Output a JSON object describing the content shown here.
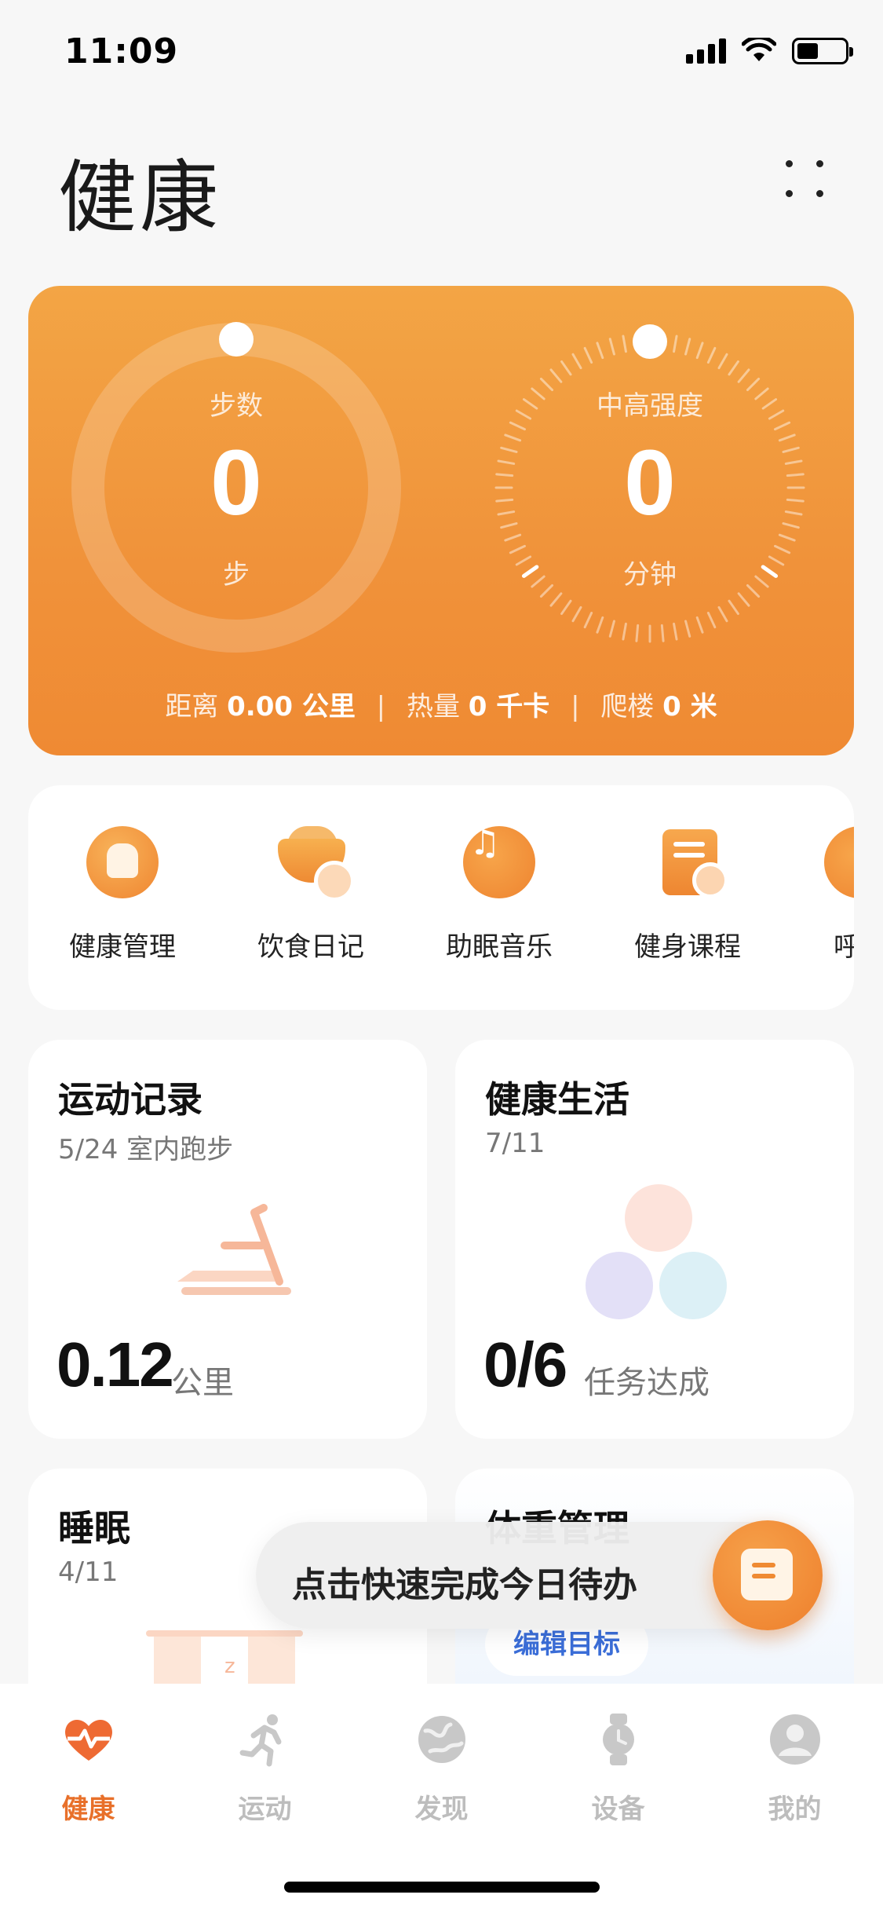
{
  "status_bar": {
    "time": "11:09"
  },
  "header": {
    "title": "健康"
  },
  "activity": {
    "steps": {
      "label": "步数",
      "value": "0",
      "unit": "步"
    },
    "intensity": {
      "label": "中高强度",
      "value": "0",
      "unit": "分钟"
    },
    "stats": {
      "distance_label": "距离",
      "distance_value": "0.00 公里",
      "calories_label": "热量",
      "calories_value": "0 千卡",
      "floors_label": "爬楼",
      "floors_value": "0 米"
    }
  },
  "shortcuts": [
    {
      "label": "健康管理",
      "icon": "health-management-icon"
    },
    {
      "label": "饮食日记",
      "icon": "diet-diary-icon"
    },
    {
      "label": "助眠音乐",
      "icon": "sleep-music-icon"
    },
    {
      "label": "健身课程",
      "icon": "fitness-course-icon"
    },
    {
      "label": "呼吸",
      "icon": "breathing-icon"
    }
  ],
  "tiles": {
    "exercise": {
      "title": "运动记录",
      "sub": "5/24 室内跑步",
      "value": "0.12",
      "unit": "公里"
    },
    "life": {
      "title": "健康生活",
      "sub": "7/11",
      "value": "0/6",
      "unit": "任务达成"
    },
    "sleep": {
      "title": "睡眠",
      "sub": "4/11"
    },
    "weight": {
      "title": "体重管理",
      "action": "编辑目标"
    }
  },
  "toast": {
    "text": "点击快速完成今日待办"
  },
  "tabbar": [
    {
      "label": "健康",
      "active": true
    },
    {
      "label": "运动"
    },
    {
      "label": "发现"
    },
    {
      "label": "设备"
    },
    {
      "label": "我的"
    }
  ],
  "colors": {
    "accent": "#ef8a33",
    "tab_active": "#e8702a",
    "link": "#3b6ed8"
  }
}
